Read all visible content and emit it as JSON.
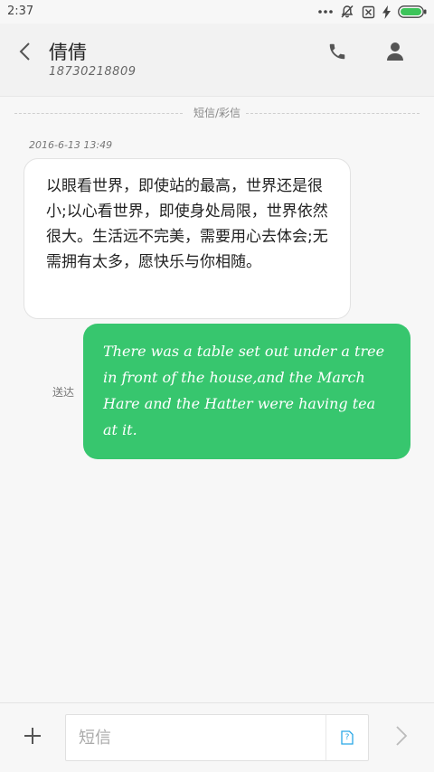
{
  "status_bar": {
    "time": "2:37",
    "icons": [
      "more-dots-icon",
      "mute-bell-icon",
      "sim-blocked-icon",
      "charging-icon",
      "battery-icon"
    ],
    "battery_color": "#3dc45a"
  },
  "header": {
    "contact_name": "倩倩",
    "contact_number": "18730218809",
    "icons": [
      "back-chevron-icon",
      "phone-icon",
      "person-icon"
    ]
  },
  "conversation": {
    "type_divider_label": "短信/彩信",
    "incoming": {
      "timestamp": "2016-6-13 13:49",
      "text": "以眼看世界，即使站的最高，世界还是很小;以心看世界，即使身处局限，世界依然很大。生活远不完美，需要用心去体会;无需拥有太多，愿快乐与你相随。"
    },
    "outgoing": {
      "status": "送达",
      "text": "There was a table set out under a tree in front of the house,and the March Hare and the Hatter were having tea at it.",
      "bubble_color": "#37c66e"
    }
  },
  "input_bar": {
    "placeholder": "短信",
    "value": "",
    "sim_label": "?",
    "icons": [
      "plus-icon",
      "sim-card-icon",
      "send-chevron-icon"
    ],
    "accent_color": "#29a7e6"
  }
}
